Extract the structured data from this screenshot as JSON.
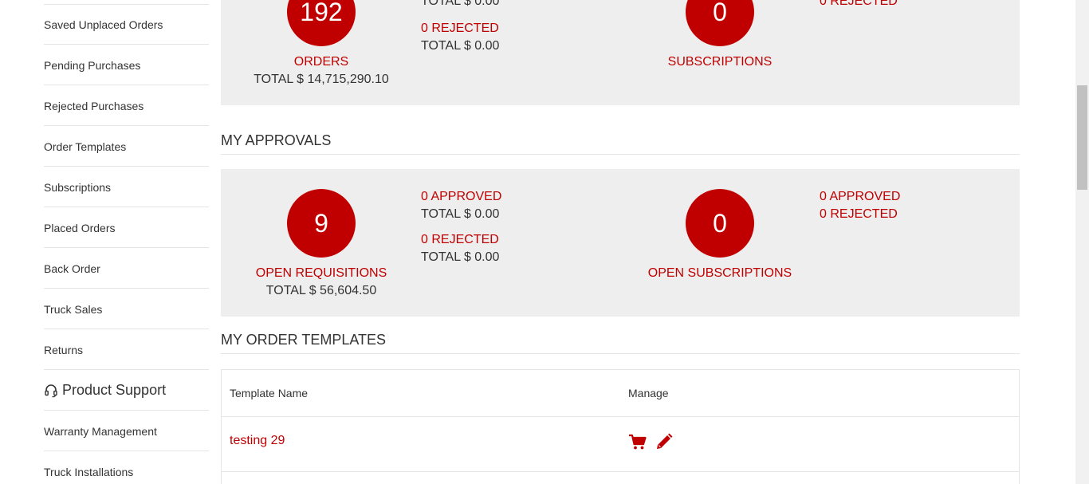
{
  "sidebar": {
    "items": [
      {
        "label": "Saved Unplaced Orders"
      },
      {
        "label": "Pending Purchases"
      },
      {
        "label": "Rejected Purchases"
      },
      {
        "label": "Order Templates"
      },
      {
        "label": "Subscriptions"
      },
      {
        "label": "Placed Orders"
      },
      {
        "label": "Back Order"
      },
      {
        "label": "Truck Sales"
      },
      {
        "label": "Returns"
      }
    ],
    "product_support": {
      "label": "Product Support",
      "icon": "headset-icon"
    },
    "support_items": [
      {
        "label": "Warranty Management"
      },
      {
        "label": "Truck Installations"
      }
    ]
  },
  "orders_panel": {
    "orders": {
      "count": "192",
      "label": "ORDERS",
      "total": "TOTAL $ 14,715,290.10",
      "partial_top_total": "TOTAL $ 0.00",
      "rejected": "0 REJECTED",
      "rejected_total": "TOTAL $ 0.00"
    },
    "subscriptions": {
      "count": "0",
      "label": "SUBSCRIPTIONS",
      "partial_top_rejected": "0 REJECTED"
    }
  },
  "approvals": {
    "heading": "MY APPROVALS",
    "requisitions": {
      "count": "9",
      "label": "OPEN REQUISITIONS",
      "total": "TOTAL $ 56,604.50",
      "approved": "0 APPROVED",
      "approved_total": "TOTAL $ 0.00",
      "rejected": "0 REJECTED",
      "rejected_total": "TOTAL $ 0.00"
    },
    "subscriptions": {
      "count": "0",
      "label": "OPEN SUBSCRIPTIONS",
      "approved": "0 APPROVED",
      "rejected": "0 REJECTED"
    }
  },
  "templates": {
    "heading": "MY ORDER TEMPLATES",
    "columns": [
      "Template Name",
      "Manage"
    ],
    "rows": [
      {
        "name": "testing 29",
        "actions": [
          "cart-icon",
          "pencil-icon"
        ]
      }
    ]
  },
  "colors": {
    "accent": "#c00000",
    "panel_bg": "#eeeeee",
    "text": "#333333",
    "divider": "#e5e5e5"
  }
}
